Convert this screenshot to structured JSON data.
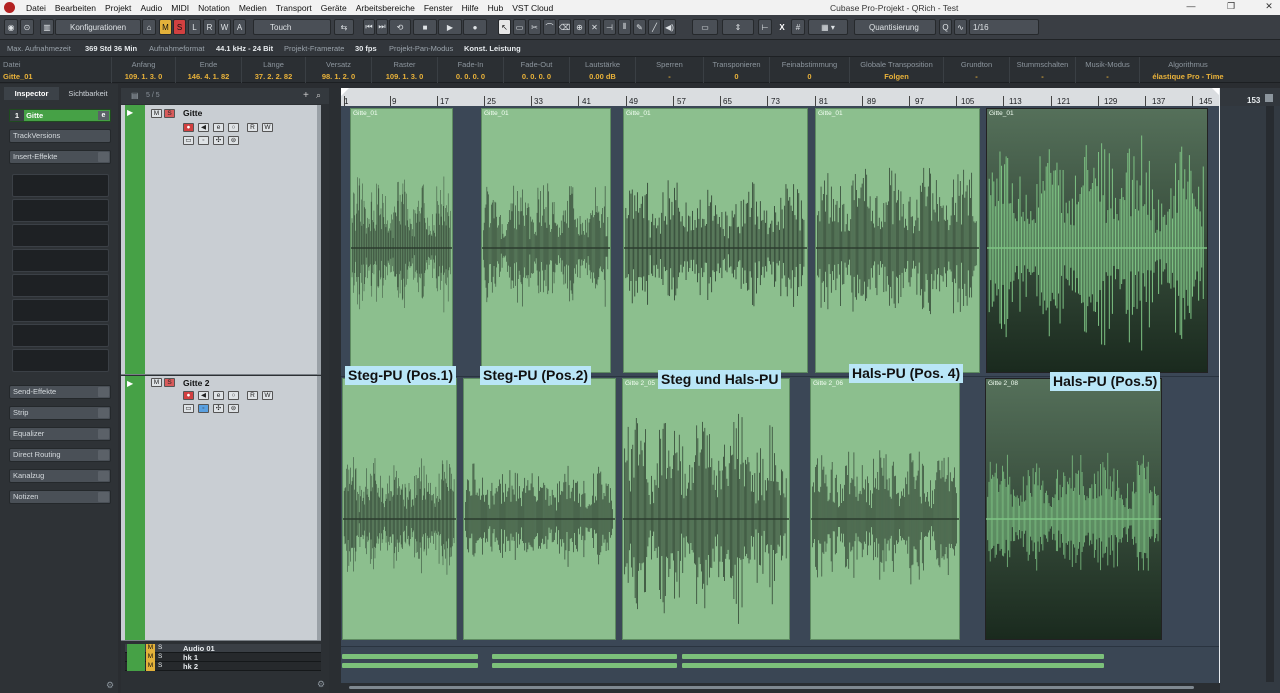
{
  "app": {
    "title": "Cubase Pro-Projekt - QRich - Test",
    "menus": [
      "Datei",
      "Bearbeiten",
      "Projekt",
      "Audio",
      "MIDI",
      "Notation",
      "Medien",
      "Transport",
      "Geräte",
      "Arbeitsbereiche",
      "Fenster",
      "Hilfe",
      "Hub",
      "VST Cloud"
    ],
    "window_controls": [
      "—",
      "❐",
      "✕"
    ]
  },
  "toolbar": {
    "configurations": "Konfigurationen",
    "modes": [
      "M",
      "S",
      "L",
      "R",
      "W",
      "A"
    ],
    "automation_mode": "Touch",
    "quantize": "Quantisierung",
    "quantize_value": "1/16",
    "snap_x": "X"
  },
  "status": {
    "max_rec_label": "Max. Aufnahmezeit",
    "max_rec_value": "369 Std 36 Min",
    "format_label": "Aufnahmeformat",
    "format_value": "44.1 kHz - 24 Bit",
    "framerate_label": "Projekt-Framerate",
    "framerate_value": "30 fps",
    "panmode_label": "Projekt-Pan-Modus",
    "panmode_value": "Konst. Leistung"
  },
  "infoline": {
    "file_label": "Datei",
    "file_value": "Gitte_01",
    "columns": [
      {
        "h": "Anfang",
        "v": "109. 1. 3. 0"
      },
      {
        "h": "Ende",
        "v": "146. 4. 1. 82"
      },
      {
        "h": "Länge",
        "v": "37. 2. 2. 82"
      },
      {
        "h": "Versatz",
        "v": "98. 1. 2. 0"
      },
      {
        "h": "Raster",
        "v": "109. 1. 3. 0"
      },
      {
        "h": "Fade-In",
        "v": "0. 0. 0. 0"
      },
      {
        "h": "Fade-Out",
        "v": "0. 0. 0. 0"
      },
      {
        "h": "Lautstärke",
        "v": "0.00  dB"
      },
      {
        "h": "Sperren",
        "v": "-"
      },
      {
        "h": "Transponieren",
        "v": "0"
      },
      {
        "h": "Feinabstimmung",
        "v": "0"
      },
      {
        "h": "Globale Transposition",
        "v": "Folgen"
      },
      {
        "h": "Grundton",
        "v": "-"
      },
      {
        "h": "Stummschalten",
        "v": "-"
      },
      {
        "h": "Musik-Modus",
        "v": "-"
      },
      {
        "h": "Algorithmus",
        "v": "élastique Pro - Time"
      }
    ]
  },
  "inspector": {
    "tabs": [
      "Inspector",
      "Sichtbarkeit"
    ],
    "track_number": "1",
    "track_name": "Gitte",
    "sections_top": [
      "TrackVersions",
      "Insert-Effekte"
    ],
    "sections_bottom": [
      "Send-Effekte",
      "Strip",
      "Equalizer",
      "Direct Routing",
      "Kanalzug",
      "Notizen"
    ]
  },
  "tracklist": {
    "counter": "5 / 5",
    "tracks": [
      {
        "name": "Gitte"
      },
      {
        "name": "Gitte 2"
      }
    ],
    "folder_tracks": [
      {
        "name": "Audio 01"
      },
      {
        "name": "hk 1"
      },
      {
        "name": "hk 2"
      }
    ],
    "mute_label": "M",
    "solo_label": "S"
  },
  "ruler": {
    "bars": [
      "1",
      "9",
      "17",
      "25",
      "33",
      "41",
      "49",
      "57",
      "65",
      "73",
      "81",
      "89",
      "97",
      "105",
      "113",
      "121",
      "129",
      "137",
      "145"
    ],
    "end_label": "153"
  },
  "events": {
    "track1": [
      "Gitte_01",
      "Gitte_01",
      "Gitte_01",
      "Gitte_01",
      "Gitte_01"
    ],
    "track2": [
      "Gitte 2_05",
      "Gitte 2_06",
      "Gitte 2_08"
    ]
  },
  "annotations": [
    "Steg-PU (Pos.1)",
    "Steg-PU (Pos.2)",
    "Steg und Hals-PU",
    "Hals-PU (Pos. 4)",
    "Hals-PU (Pos.5)"
  ],
  "colors": {
    "track_green": "#46a146",
    "event_green": "#8cbf8e",
    "label_bg": "#b9e6f7",
    "accent_orange": "#e9b23a"
  }
}
